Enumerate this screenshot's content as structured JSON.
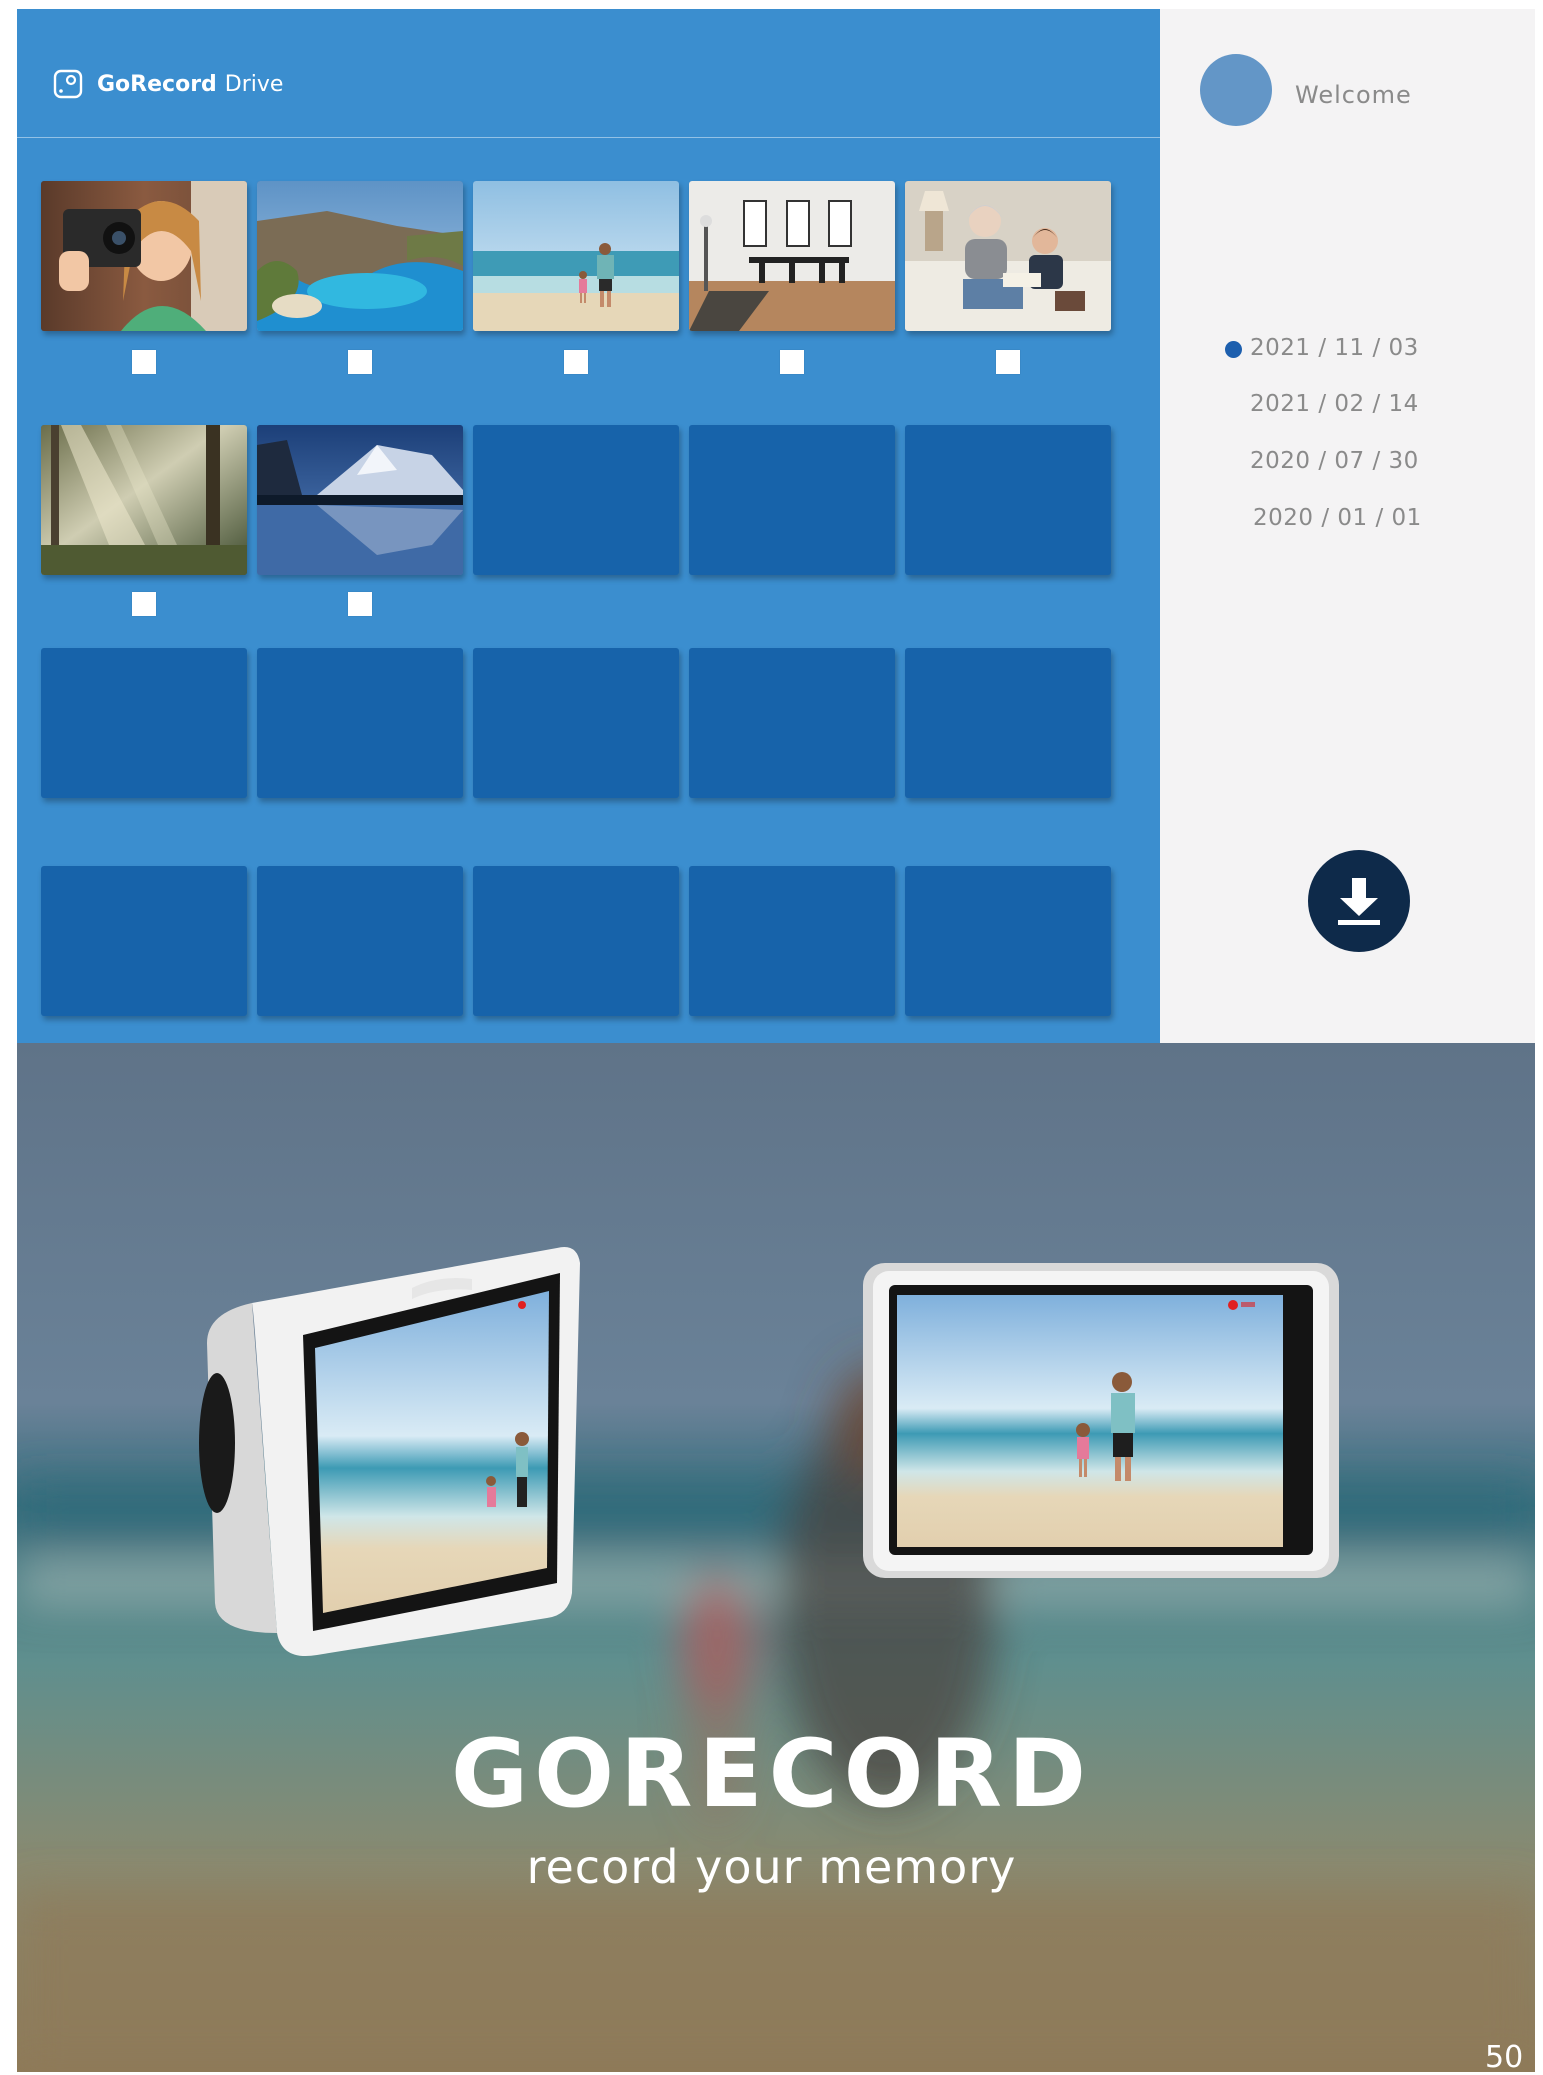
{
  "app": {
    "brand": "GoRecord",
    "suffix": "Drive"
  },
  "photos": [
    {
      "name": "girl with camera",
      "checked": false
    },
    {
      "name": "coastal cove",
      "checked": false
    },
    {
      "name": "father and child on beach",
      "checked": false
    },
    {
      "name": "dining room",
      "checked": false
    },
    {
      "name": "grandmother reading with boy",
      "checked": false
    },
    {
      "name": "forest sunbeams",
      "checked": false
    },
    {
      "name": "mountain lake",
      "checked": false
    }
  ],
  "empty_slots": 13,
  "sidebar": {
    "welcome": "Welcome",
    "dates": [
      "2021 / 11 / 03",
      "2021 / 02 / 14",
      "2020 / 07 / 30",
      "2020 / 01 / 01"
    ],
    "selected_date_index": 0
  },
  "promo": {
    "title": "GORECORD",
    "tagline": "record your memory"
  },
  "page_number": "50",
  "colors": {
    "panel_blue": "#3b8ecf",
    "tile_blue": "#1763aa",
    "sidebar_bg": "#f4f3f4",
    "download_navy": "#0e2a4a",
    "selected_dot": "#1d5fae"
  },
  "icons": {
    "logo": "camera-logo-icon",
    "download": "download-icon"
  }
}
